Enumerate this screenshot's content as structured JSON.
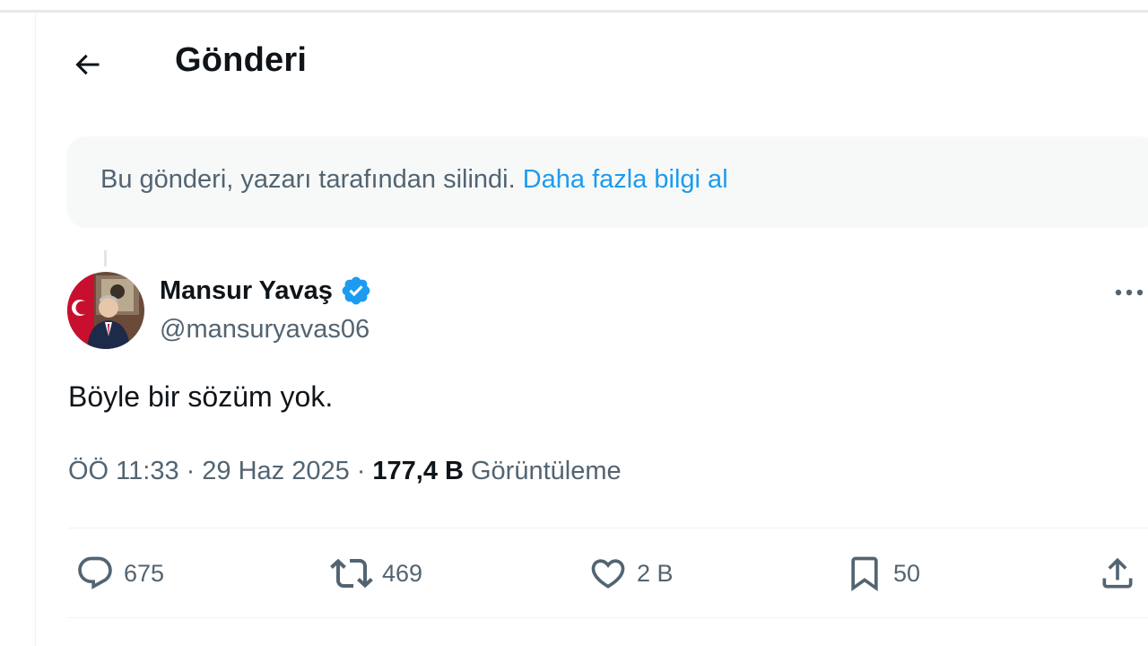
{
  "header": {
    "title": "Gönderi",
    "back_icon": "arrow-left-icon"
  },
  "notice": {
    "text": "Bu gönderi, yazarı tarafından silindi.",
    "link": "Daha fazla bilgi al"
  },
  "tweet": {
    "author_name": "Mansur Yavaş",
    "author_handle": "@mansuryavas06",
    "verified_icon": "verified-badge-icon",
    "verified_color": "#1d9bf0",
    "text": "Böyle bir sözüm yok.",
    "time": "ÖÖ 11:33",
    "date": "29 Haz 2025",
    "views_count": "177,4 B",
    "views_label": "Görüntüleme",
    "separator": "·"
  },
  "actions": {
    "reply_count": "675",
    "retweet_count": "469",
    "like_count": "2 B",
    "bookmark_count": "50",
    "icons": [
      "reply-icon",
      "retweet-icon",
      "like-icon",
      "bookmark-icon",
      "share-icon"
    ]
  },
  "colors": {
    "accent": "#1d9bf0",
    "text_primary": "#0f1419",
    "text_secondary": "#536471",
    "notice_bg": "#f7f9f9"
  }
}
